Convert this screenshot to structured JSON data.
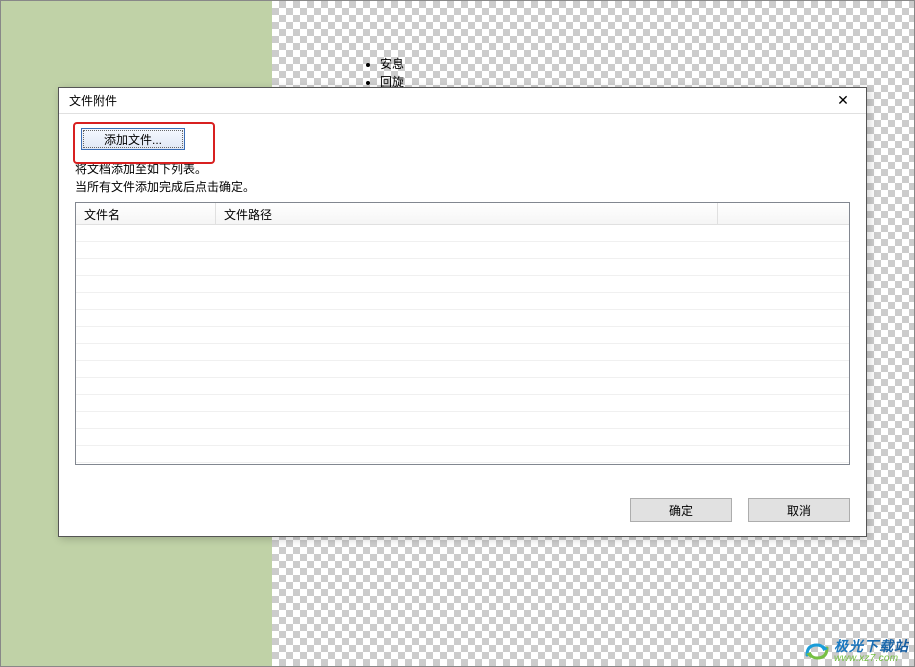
{
  "document": {
    "bullets": [
      "安息",
      "回旋"
    ]
  },
  "dialog": {
    "title": "文件附件",
    "add_file_label": "添加文件...",
    "hint_line1": "将文档添加至如下列表。",
    "hint_line2": "当所有文件添加完成后点击确定。",
    "columns": {
      "name": "文件名",
      "path": "文件路径"
    },
    "buttons": {
      "ok": "确定",
      "cancel": "取消"
    }
  },
  "watermark": {
    "brand": "极光下载站",
    "url": "www.xz7.com"
  }
}
